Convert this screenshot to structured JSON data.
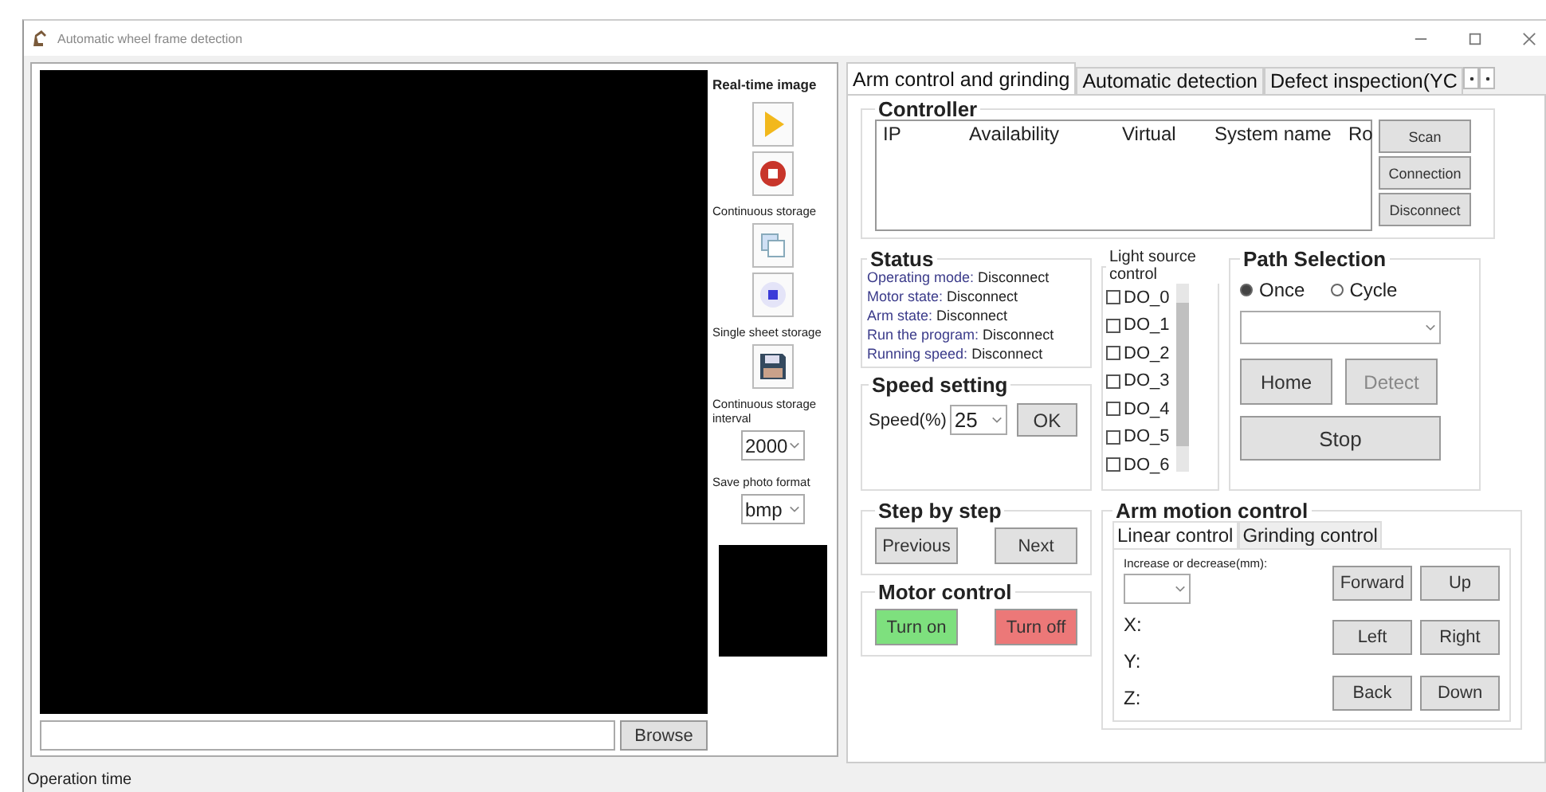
{
  "window": {
    "title": "Automatic wheel frame detection"
  },
  "camera_panel": {
    "sections": [
      {
        "kind": "icons",
        "label": "Real-time image",
        "icons": [
          {
            "kind": "play"
          },
          {
            "kind": "stop"
          }
        ]
      },
      {
        "kind": "icons",
        "label": "Continuous storage",
        "icons": [
          {
            "kind": "copy"
          },
          {
            "kind": "record"
          }
        ]
      },
      {
        "kind": "icons",
        "label": "Single sheet storage",
        "icons": [
          {
            "kind": "save"
          }
        ]
      },
      {
        "kind": "combo",
        "label": "Continuous storage interval",
        "value": "2000"
      },
      {
        "kind": "combo",
        "label": "Save photo format",
        "value": "bmp"
      }
    ],
    "browse_button": "Browse"
  },
  "tabs": [
    {
      "label": "Arm control and grinding",
      "selected": true
    },
    {
      "label": "Automatic detection",
      "selected": false
    },
    {
      "label": "Defect inspection(YC",
      "selected": false
    }
  ],
  "controller": {
    "title": "Controller",
    "columns": [
      "IP",
      "Availability",
      "Virtual",
      "System name",
      "Ro"
    ],
    "buttons": [
      "Scan",
      "Connection",
      "Disconnect"
    ]
  },
  "status": {
    "title": "Status",
    "rows": [
      {
        "label": "Operating mode:",
        "value": "Disconnect"
      },
      {
        "label": "Motor state:",
        "value": "Disconnect"
      },
      {
        "label": "Arm state:",
        "value": "Disconnect"
      },
      {
        "label": "Run the program:",
        "value": "Disconnect"
      },
      {
        "label": "Running speed:",
        "value": "Disconnect"
      }
    ]
  },
  "speed_setting": {
    "title": "Speed setting",
    "label": "Speed(%)",
    "value": "25",
    "button": "OK"
  },
  "light_source": {
    "title": "Light source control",
    "items": [
      {
        "label": "DO_0",
        "checked": false
      },
      {
        "label": "DO_1",
        "checked": false
      },
      {
        "label": "DO_2",
        "checked": false
      },
      {
        "label": "DO_3",
        "checked": false
      },
      {
        "label": "DO_4",
        "checked": false
      },
      {
        "label": "DO_5",
        "checked": false
      },
      {
        "label": "DO_6",
        "checked": false
      }
    ]
  },
  "path_selection": {
    "title": "Path Selection",
    "options": [
      {
        "label": "Once",
        "selected": true
      },
      {
        "label": "Cycle",
        "selected": false
      }
    ],
    "buttons": [
      {
        "label": "Home",
        "disabled": false
      },
      {
        "label": "Detect",
        "disabled": true
      }
    ],
    "stop_button": "Stop"
  },
  "step_by_step": {
    "title": "Step by step",
    "buttons": [
      "Previous",
      "Next"
    ]
  },
  "motor_control": {
    "title": "Motor control",
    "buttons": [
      {
        "label": "Turn on",
        "color": "#7ee07e"
      },
      {
        "label": "Turn off",
        "color": "#ec7878"
      }
    ]
  },
  "arm_motion": {
    "title": "Arm motion control",
    "tabs": [
      {
        "label": "Linear control",
        "selected": true
      },
      {
        "label": "Grinding control",
        "selected": false
      }
    ],
    "increment_label": "Increase or decrease(mm):",
    "axes": [
      "X:",
      "Y:",
      "Z:"
    ],
    "buttons": [
      "Forward",
      "Up",
      "Left",
      "Right",
      "Back",
      "Down"
    ]
  },
  "status_bar": {
    "text": "Operation time"
  }
}
